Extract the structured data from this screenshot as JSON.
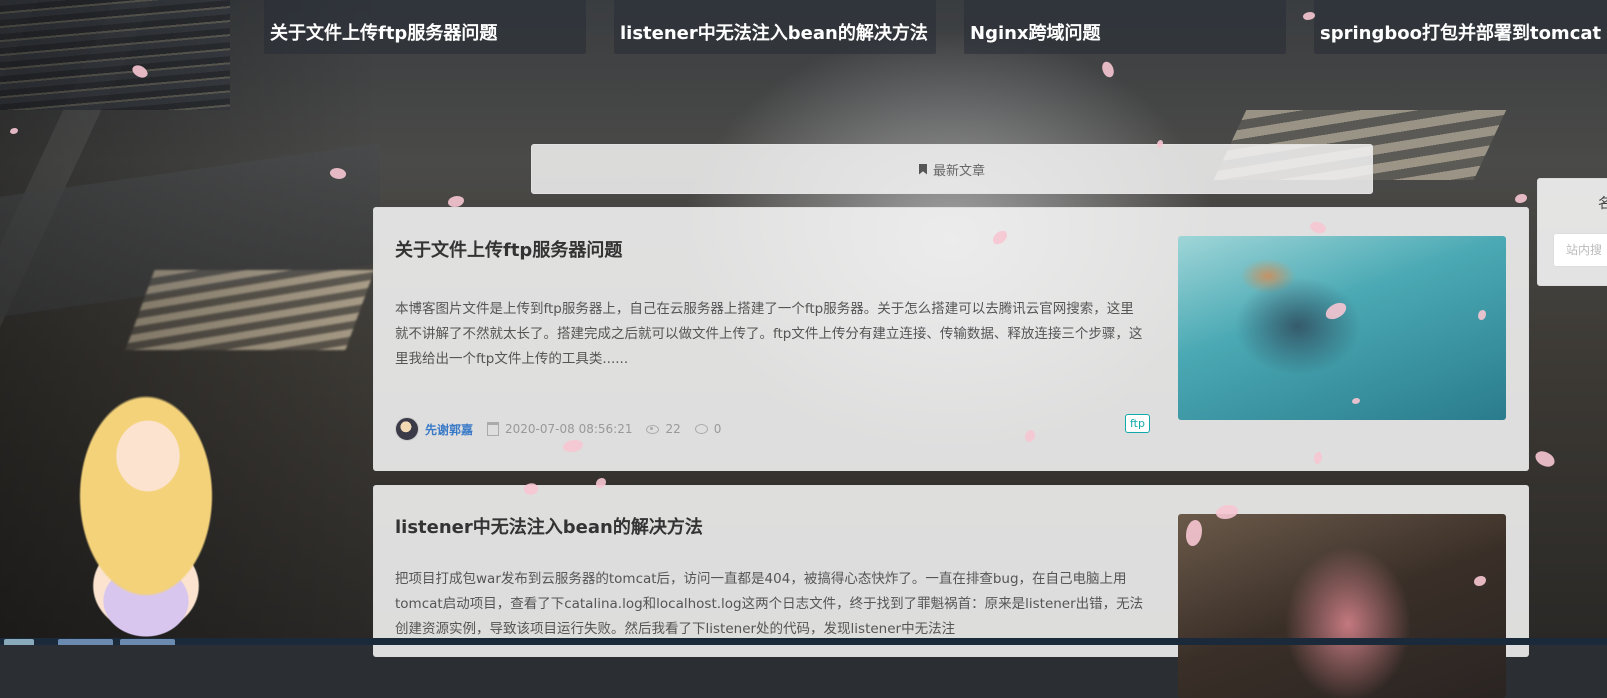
{
  "carousel": [
    {
      "caption": "关于文件上传ftp服务器问题"
    },
    {
      "caption": "listener中无法注入bean的解决方法"
    },
    {
      "caption": "Nginx跨域问题"
    },
    {
      "caption": "springboo打包并部署到tomcat"
    }
  ],
  "section": {
    "title": "最新文章"
  },
  "articles": [
    {
      "title": "关于文件上传ftp服务器问题",
      "excerpt": "本博客图片文件是上传到ftp服务器上，自己在云服务器上搭建了一个ftp服务器。关于怎么搭建可以去腾讯云官网搜索，这里就不讲解了不然就太长了。搭建完成之后就可以做文件上传了。ftp文件上传分有建立连接、传输数据、释放连接三个步骤，这里我给出一个ftp文件上传的工具类......",
      "author": "先谢郭嘉",
      "date": "2020-07-08 08:56:21",
      "views": "22",
      "comments": "0",
      "tag": "ftp"
    },
    {
      "title": "listener中无法注入bean的解决方法",
      "excerpt": "把项目打成包war发布到云服务器的tomcat后，访问一直都是404，被搞得心态快炸了。一直在排查bug，在自己电脑上用tomcat启动项目，查看了下catalina.log和localhost.log这两个日志文件，终于找到了罪魁祸首：原来是listener出错，无法创建资源实例，导致该项目运行失败。然后我看了下listener处的代码，发现listener中无法注"
    }
  ],
  "sidebar": {
    "heading": "名",
    "search_placeholder": "站内搜"
  },
  "colors": {
    "author": "#3a7bc8",
    "tag": "#11aaaa",
    "petal": "#f7c6d3"
  }
}
